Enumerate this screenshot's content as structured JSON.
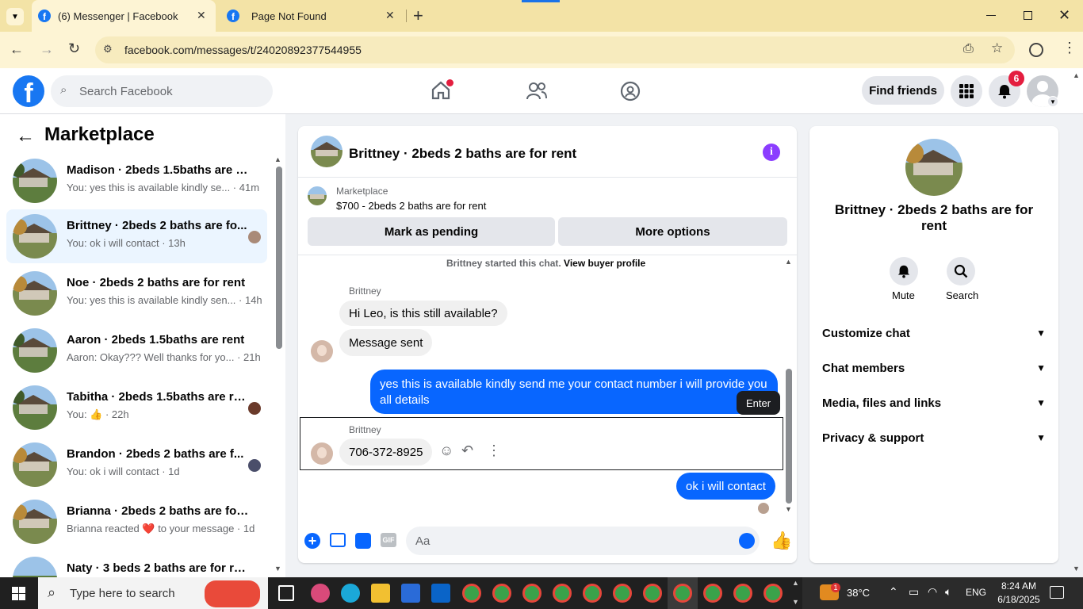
{
  "browser": {
    "tabs": [
      {
        "title": "(6) Messenger | Facebook",
        "active": true
      },
      {
        "title": "Page Not Found",
        "active": false
      }
    ],
    "url": "facebook.com/messages/t/24020892377544955"
  },
  "fb_header": {
    "search_placeholder": "Search Facebook",
    "find_friends": "Find friends",
    "notif_count": "6"
  },
  "sidebar": {
    "title": "Marketplace",
    "conversations": [
      {
        "title": "Madison · 2beds 1.5baths are rent",
        "preview": "You: yes this is available kindly se... · 41m"
      },
      {
        "title": "Brittney · 2beds 2 baths are fo...",
        "preview": "You: ok i will contact · 13h"
      },
      {
        "title": "Noe · 2beds 2 baths are for rent",
        "preview": "You: yes this is available kindly sen... · 14h"
      },
      {
        "title": "Aaron · 2beds 1.5baths are rent",
        "preview": "Aaron: Okay??? Well thanks for yo... · 21h"
      },
      {
        "title": "Tabitha · 2beds 1.5baths are re...",
        "preview": "You: 👍 · 22h"
      },
      {
        "title": "Brandon · 2beds 2 baths are f...",
        "preview": "You: ok i will contact · 1d"
      },
      {
        "title": "Brianna · 2beds 2 baths are for r...",
        "preview": "Brianna reacted ❤️ to your message · 1d"
      },
      {
        "title": "Naty · 3 beds 2 baths are for rent",
        "preview": ""
      }
    ]
  },
  "chat": {
    "title": "Brittney · 2beds 2 baths are for rent",
    "listing_source": "Marketplace",
    "listing": "$700 - 2beds 2 baths are for rent",
    "mark_pending": "Mark as pending",
    "more_options": "More options",
    "started_text": "Brittney started this chat.",
    "view_profile": "View buyer profile",
    "sender_name": "Brittney",
    "messages": [
      {
        "from": "them",
        "text": "Hi Leo, is this still available?"
      },
      {
        "from": "them",
        "text": "Message sent"
      },
      {
        "from": "me",
        "text": "yes  this is available kindly send me your contact number i will provide you all details"
      },
      {
        "from": "them",
        "text": "706-372-8925"
      },
      {
        "from": "me",
        "text": "ok i will contact"
      }
    ],
    "tooltip": "Enter",
    "composer_placeholder": "Aa",
    "gif_label": "GIF"
  },
  "details": {
    "name": "Brittney · 2beds 2 baths are for rent",
    "mute": "Mute",
    "search": "Search",
    "sections": [
      "Customize chat",
      "Chat members",
      "Media, files and links",
      "Privacy & support"
    ]
  },
  "taskbar": {
    "search_placeholder": "Type here to search",
    "temperature": "38°C",
    "language": "ENG",
    "time": "8:24 AM",
    "date": "6/18/2025",
    "weather_badge": "1"
  },
  "colors": {
    "accent": "#0866ff",
    "purple": "#8b3dff",
    "fb_blue": "#1877f2"
  }
}
